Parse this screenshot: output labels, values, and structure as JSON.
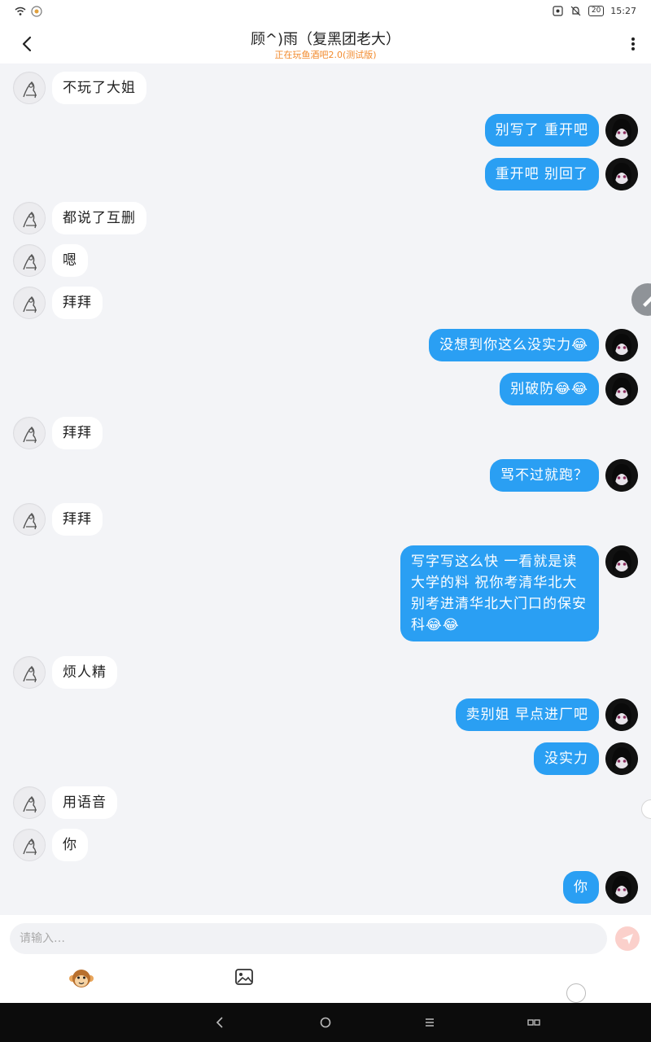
{
  "status": {
    "battery": "20",
    "time": "15:27"
  },
  "header": {
    "title": "顾^)雨（复黑团老大）",
    "subtitle": "正在玩鱼酒吧2.0(测试版)"
  },
  "messages": [
    {
      "side": "left",
      "text": "不玩了大姐"
    },
    {
      "side": "right",
      "text": "别写了 重开吧"
    },
    {
      "side": "right",
      "text": "重开吧 别回了"
    },
    {
      "side": "left",
      "text": "都说了互删"
    },
    {
      "side": "left",
      "text": "嗯"
    },
    {
      "side": "left",
      "text": "拜拜"
    },
    {
      "side": "right",
      "text": "没想到你这么没实力😂"
    },
    {
      "side": "right",
      "text": "别破防😂😂"
    },
    {
      "side": "left",
      "text": "拜拜"
    },
    {
      "side": "right",
      "text": "骂不过就跑？"
    },
    {
      "side": "left",
      "text": "拜拜"
    },
    {
      "side": "right",
      "text": "写字写这么快 一看就是读大学的料 祝你考清华北大 别考进清华北大门口的保安科😂😂"
    },
    {
      "side": "left",
      "text": "烦人精"
    },
    {
      "side": "right",
      "text": "卖别姐 早点进厂吧"
    },
    {
      "side": "right",
      "text": "没实力"
    },
    {
      "side": "left",
      "text": "用语音"
    },
    {
      "side": "left",
      "text": "你"
    },
    {
      "side": "right",
      "text": "你"
    }
  ],
  "composer": {
    "placeholder": "请输入…"
  },
  "icons": {
    "emoji": "monkey-emoji-icon",
    "image": "image-icon",
    "send": "send-icon"
  }
}
